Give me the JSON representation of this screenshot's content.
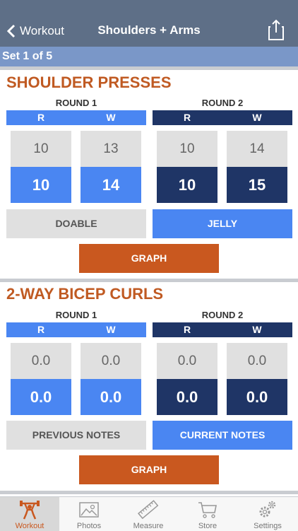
{
  "nav": {
    "back_label": "Workout",
    "title": "Shoulders + Arms",
    "icons": {
      "back": "chevron-left-icon",
      "share": "share-icon"
    }
  },
  "set_label": "Set 1 of 5",
  "colors": {
    "nav": "#5e6f87",
    "set_bar": "#7a97c8",
    "round1": "#4a86f2",
    "round2": "#1f3566",
    "accent": "#c9581f",
    "title": "#c05a22"
  },
  "exercises": [
    {
      "title": "SHOULDER PRESSES",
      "rounds": [
        {
          "label": "ROUND 1",
          "r_label": "R",
          "w_label": "W",
          "prev_r": "10",
          "prev_w": "13",
          "cur_r": "10",
          "cur_w": "14"
        },
        {
          "label": "ROUND 2",
          "r_label": "R",
          "w_label": "W",
          "prev_r": "10",
          "prev_w": "14",
          "cur_r": "10",
          "cur_w": "15"
        }
      ],
      "left_button": "DOABLE",
      "right_button": "JELLY",
      "graph_button": "GRAPH"
    },
    {
      "title": "2-WAY BICEP CURLS",
      "rounds": [
        {
          "label": "ROUND 1",
          "r_label": "R",
          "w_label": "W",
          "prev_r": "0.0",
          "prev_w": "0.0",
          "cur_r": "0.0",
          "cur_w": "0.0"
        },
        {
          "label": "ROUND 2",
          "r_label": "R",
          "w_label": "W",
          "prev_r": "0.0",
          "prev_w": "0.0",
          "cur_r": "0.0",
          "cur_w": "0.0"
        }
      ],
      "left_button": "PREVIOUS NOTES",
      "right_button": "CURRENT NOTES",
      "graph_button": "GRAPH"
    }
  ],
  "tabs": [
    {
      "label": "Workout",
      "icon": "weightlifter-icon",
      "active": true
    },
    {
      "label": "Photos",
      "icon": "photo-icon",
      "active": false
    },
    {
      "label": "Measure",
      "icon": "ruler-icon",
      "active": false
    },
    {
      "label": "Store",
      "icon": "cart-icon",
      "active": false
    },
    {
      "label": "Settings",
      "icon": "gears-icon",
      "active": false
    }
  ]
}
